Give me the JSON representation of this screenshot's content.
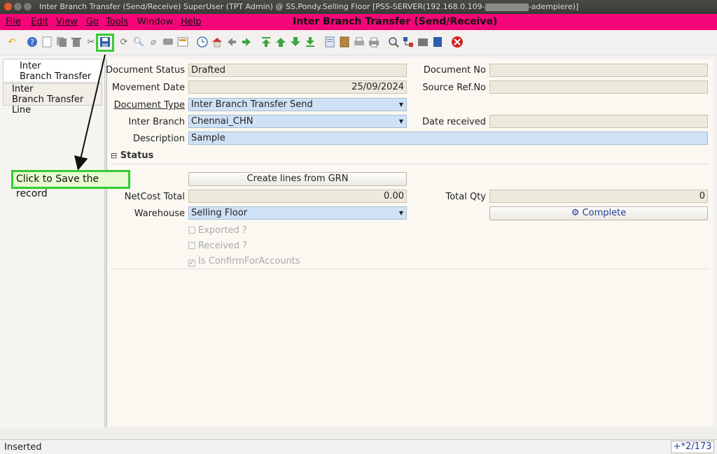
{
  "window": {
    "title": "Inter Branch Transfer (Send/Receive)  SuperUser (TPT Admin) @ SS.Pondy.Selling Floor [PSS-SERVER(192.168.0.109-",
    "title_suffix": "-adempiere)]"
  },
  "menu": {
    "file": "File",
    "edit": "Edit",
    "view": "View",
    "go": "Go",
    "tools": "Tools",
    "window": "Window",
    "help": "Help",
    "window_title": "Inter Branch Transfer (Send/Receive)"
  },
  "toolbar": {
    "icons": [
      "undo-icon",
      "help-icon",
      "new-icon",
      "copy-icon",
      "delete-icon",
      "delete-selection-icon",
      "save-icon",
      "refresh-icon",
      "find-icon",
      "attachment-icon",
      "chat-icon",
      "grid-toggle-icon",
      "history-icon",
      "home-icon",
      "back-icon",
      "forward-icon",
      "first-record-icon",
      "previous-record-icon",
      "next-record-icon",
      "last-record-icon",
      "report-icon",
      "archive-icon",
      "print-preview-icon",
      "print-icon",
      "zoom-across-icon",
      "active-workflows-icon",
      "requests-icon",
      "product-info-icon",
      "exit-icon"
    ]
  },
  "tabs": {
    "header": "Inter\nBranch Transfer",
    "header_line1": "Inter",
    "header_line2": "Branch Transfer",
    "line_line1": "Inter",
    "line_line2": "Branch Transfer Line"
  },
  "annotation": {
    "callout": "Click to Save the record"
  },
  "form": {
    "document_status_label": "Document Status",
    "document_status_value": "Drafted",
    "document_no_label": "Document No",
    "document_no_value": "",
    "movement_date_label": "Movement Date",
    "movement_date_value": "25/09/2024",
    "source_ref_label": "Source Ref.No",
    "source_ref_value": "",
    "document_type_label": "Document Type",
    "document_type_value": "Inter Branch Transfer Send",
    "inter_branch_label": "Inter Branch",
    "inter_branch_value": "Chennai_CHN",
    "date_received_label": "Date received",
    "date_received_value": "",
    "description_label": "Description",
    "description_value": "Sample",
    "status_section": "Status",
    "create_lines_button": "Create lines from GRN",
    "netcost_label": "NetCost Total",
    "netcost_value": "0.00",
    "total_qty_label": "Total Qty",
    "total_qty_value": "0",
    "warehouse_label": "Warehouse",
    "warehouse_value": "Selling Floor",
    "complete_button": "Complete",
    "exported_label": "Exported ?",
    "received_label": "Received ?",
    "confirm_label": "Is ConfirmForAccounts"
  },
  "status": {
    "message": "Inserted",
    "record_nav": "+*2/173"
  },
  "colors": {
    "menubar": "#f60579",
    "highlight": "#33cc33",
    "mandatory_field": "#cfe1f5"
  }
}
